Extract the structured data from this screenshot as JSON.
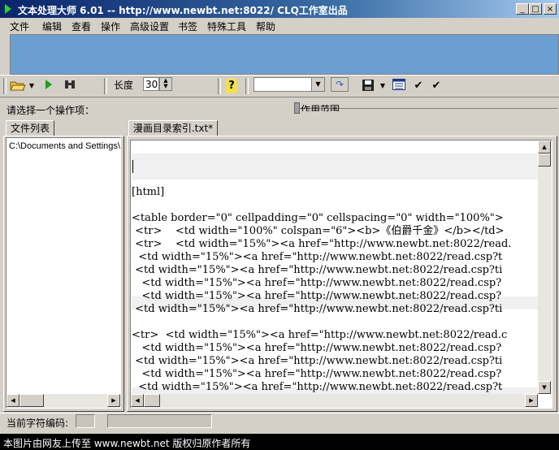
{
  "window": {
    "title": "文本处理大师 6.01 -- http://www.newbt.net:8022/ CLQ工作室出品",
    "minimize_glyph": "_",
    "maximize_glyph": "□",
    "close_glyph": "×"
  },
  "menu": [
    "文件",
    "编辑",
    "查看",
    "操作",
    "高级设置",
    "书签",
    "特殊工具",
    "帮助"
  ],
  "toolbar": {
    "length_label": "长度",
    "length_value": "30",
    "combo_value": "",
    "icons": [
      "open-folder-icon",
      "run-icon",
      "find-icon",
      "help-icon",
      "go-icon",
      "save-icon",
      "list-icon",
      "check-icon",
      "check-icon"
    ]
  },
  "operation": {
    "prompt": "请选择一个操作项：",
    "scope_label": "作用范围"
  },
  "file_panel": {
    "tab_label": "文件列表",
    "path": "C:\\Documents and Settings\\"
  },
  "editor": {
    "tab_label": "漫画目录索引.txt*",
    "lines": [
      "",
      "",
      "",
      "[html]",
      "",
      "<table border=\"0\" cellpadding=\"0\" cellspacing=\"0\" width=\"100%\">",
      " <tr>    <td width=\"100%\" colspan=\"6\"><b>《伯爵千金》</b></td>",
      " <tr>    <td width=\"15%\"><a href=\"http://www.newbt.net:8022/read.",
      "  <td width=\"15%\"><a href=\"http://www.newbt.net:8022/read.csp?t",
      " <td width=\"15%\"><a href=\"http://www.newbt.net:8022/read.csp?ti",
      "   <td width=\"15%\"><a href=\"http://www.newbt.net:8022/read.csp?",
      "   <td width=\"15%\"><a href=\"http://www.newbt.net:8022/read.csp?",
      " <td width=\"15%\"><a href=\"http://www.newbt.net:8022/read.csp?ti",
      "",
      "<tr>  <td width=\"15%\"><a href=\"http://www.newbt.net:8022/read.c",
      "   <td width=\"15%\"><a href=\"http://www.newbt.net:8022/read.csp?",
      " <td width=\"15%\"><a href=\"http://www.newbt.net:8022/read.csp?ti",
      "   <td width=\"15%\"><a href=\"http://www.newbt.net:8022/read.csp?",
      "  <td width=\"15%\"><a href=\"http://www.newbt.net:8022/read.csp?t",
      "  <td width=\"15%\"><a href=\"http://www.newbt.net:8022/read.csp?t"
    ]
  },
  "status": {
    "encoding_label": "当前字符编码:"
  },
  "footer": {
    "text": "本图片由网友上传至 www.newbt.net 版权归原作者所有"
  },
  "colors": {
    "title_bar": "#0a246a",
    "blue_panel": "#6b9fd1",
    "shaded_line": "#f0f0f0"
  }
}
